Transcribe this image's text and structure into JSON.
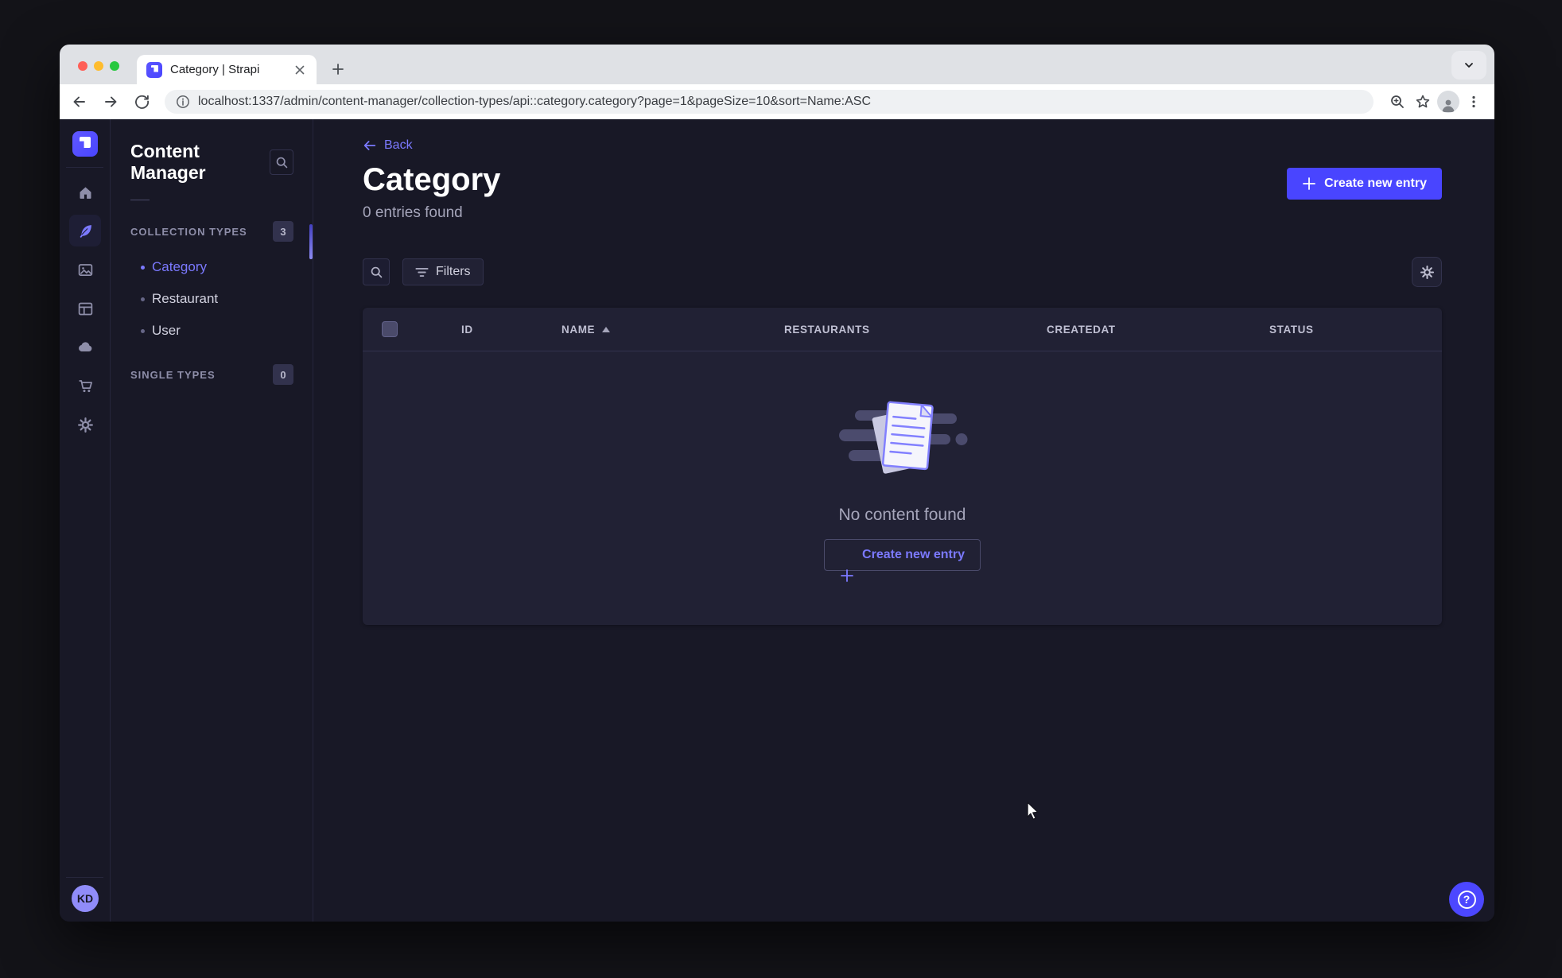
{
  "colors": {
    "primary": "#4945ff",
    "primary_light": "#7b79ff",
    "app_background": "#181826",
    "surface": "#212134",
    "border": "#32324d",
    "text_muted": "#a5a5ba",
    "chrome_tabstrip": "#dfe1e5",
    "traffic_red": "#ff5f57",
    "traffic_yellow": "#febc2e",
    "traffic_green": "#28c840"
  },
  "browser": {
    "tab_title": "Category | Strapi",
    "url": "localhost:1337/admin/content-manager/collection-types/api::category.category?page=1&pageSize=10&sort=Name:ASC"
  },
  "subnav": {
    "title": "Content Manager",
    "collection_types": {
      "label": "COLLECTION TYPES",
      "count": "3",
      "items": [
        {
          "label": "Category",
          "active": true
        },
        {
          "label": "Restaurant",
          "active": false
        },
        {
          "label": "User",
          "active": false
        }
      ]
    },
    "single_types": {
      "label": "SINGLE TYPES",
      "count": "0"
    }
  },
  "header": {
    "back_label": "Back",
    "title": "Category",
    "entries_found": "0 entries found",
    "create_button_label": "Create new entry"
  },
  "filters": {
    "label": "Filters"
  },
  "table": {
    "columns": [
      "ID",
      "NAME",
      "RESTAURANTS",
      "CREATEDAT",
      "STATUS"
    ],
    "sorted_by": "NAME",
    "sort_direction": "ASC"
  },
  "empty_state": {
    "message": "No content found",
    "create_button_label": "Create new entry"
  },
  "user": {
    "initials": "KD"
  },
  "help": {
    "label": "?"
  }
}
